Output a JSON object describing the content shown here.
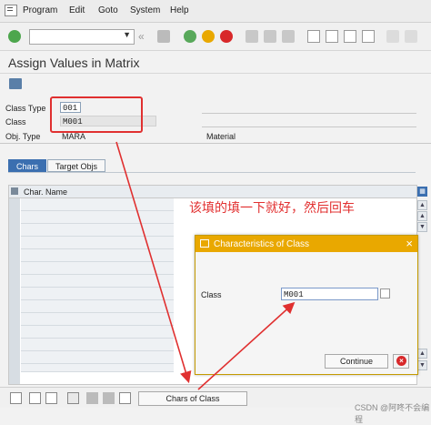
{
  "menu": {
    "items": [
      "Program",
      "Edit",
      "Goto",
      "System",
      "Help"
    ]
  },
  "toolbar": {
    "command_field": ""
  },
  "page": {
    "title": "Assign Values in Matrix"
  },
  "header": {
    "class_type_label": "Class Type",
    "class_type_value": "001",
    "class_label": "Class",
    "class_value": "M001",
    "obj_type_label": "Obj. Type",
    "obj_type_value": "MARA",
    "obj_type_desc": "Material"
  },
  "tabs": [
    {
      "label": "Chars"
    },
    {
      "label": "Target Objs"
    }
  ],
  "table": {
    "column_header": "Char. Name"
  },
  "annotation": {
    "text": "该填的填一下就好，然后回车"
  },
  "dialog": {
    "title": "Characteristics of Class",
    "class_label": "Class",
    "class_value": "M001",
    "continue_label": "Continue"
  },
  "bottom": {
    "chars_of_class_label": "Chars of Class"
  },
  "watermark": {
    "text": "CSDN @阿咚不会编程"
  },
  "colors": {
    "annotation_red": "#e23030",
    "dialog_titlebar": "#e9a800",
    "tab_active": "#3b6fb0"
  }
}
